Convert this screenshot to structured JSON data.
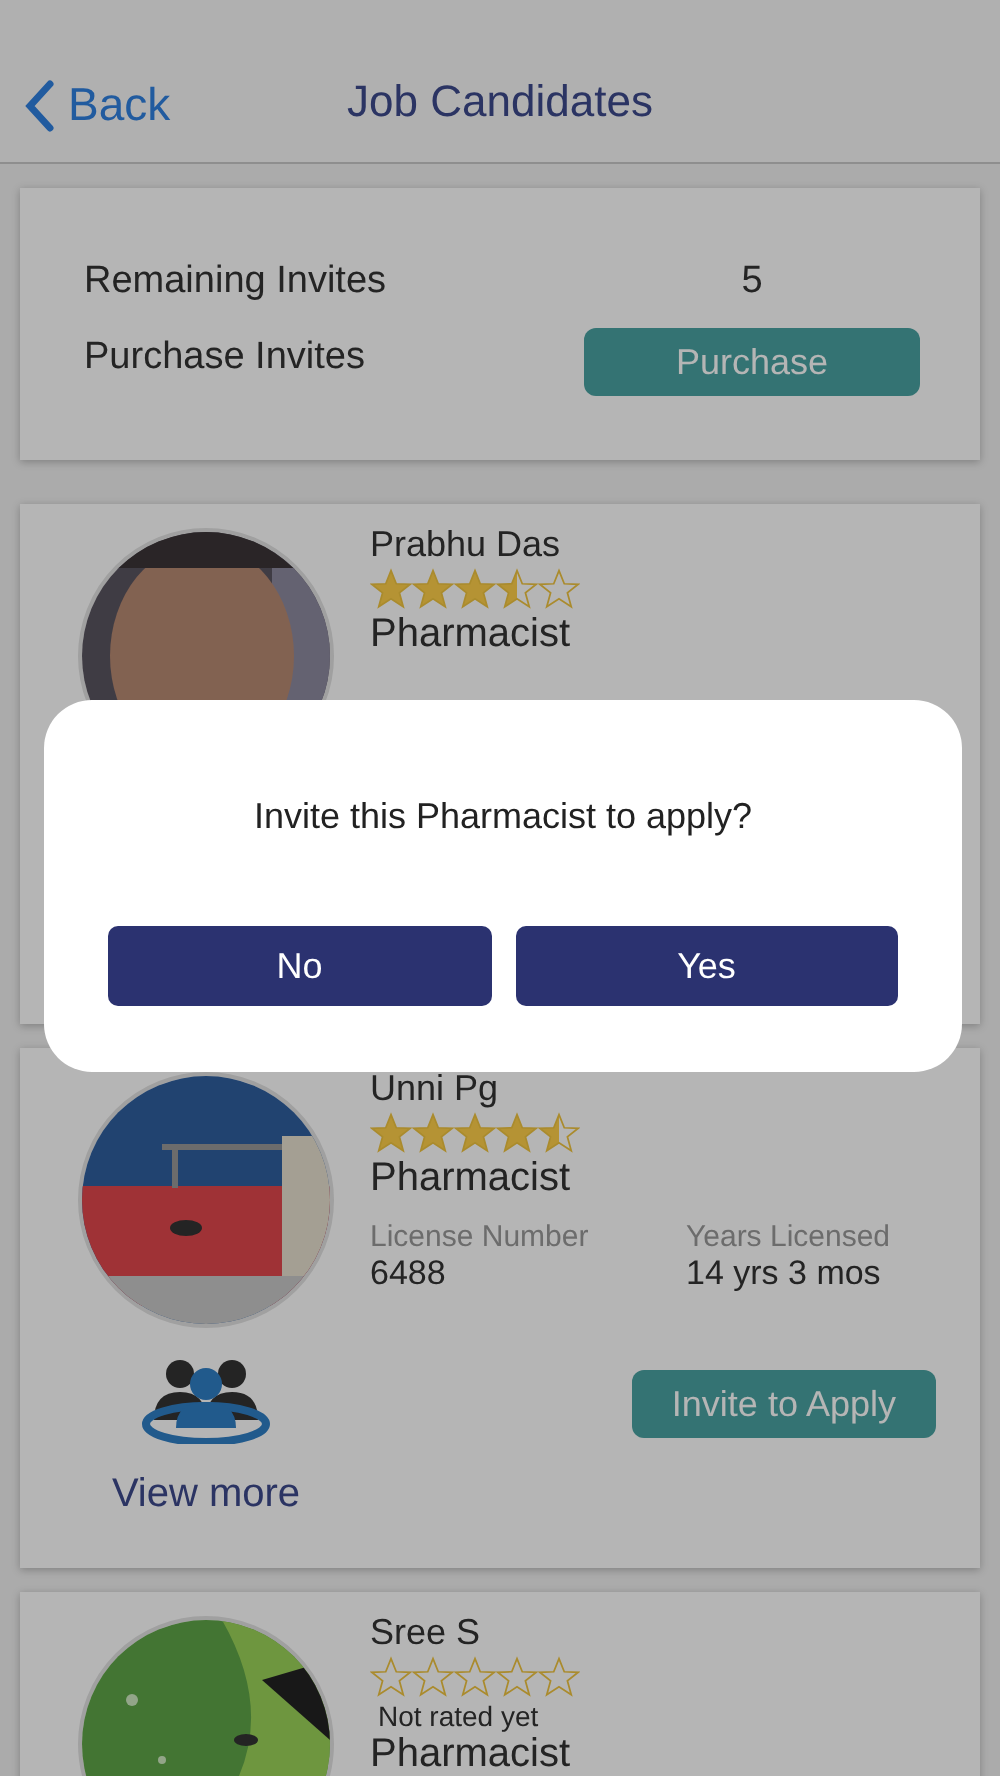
{
  "header": {
    "back": "Back",
    "title": "Job Candidates"
  },
  "invites": {
    "remaining_label": "Remaining Invites",
    "remaining_value": "5",
    "purchase_label": "Purchase Invites",
    "purchase_button": "Purchase"
  },
  "candidates": [
    {
      "name": "Prabhu Das",
      "stars": 3.5,
      "title": "Pharmacist"
    },
    {
      "name": "Unni Pg",
      "stars": 4.5,
      "title": "Pharmacist",
      "license_label": "License Number",
      "license_number": "6488",
      "years_label": "Years Licensed",
      "years_value": "14 yrs 3 mos",
      "invite_button": "Invite to Apply",
      "view_more": "View more"
    },
    {
      "name": "Sree S",
      "stars": 0,
      "rating_note": "Not rated yet",
      "title": "Pharmacist"
    }
  ],
  "dialog": {
    "message": "Invite this Pharmacist to apply?",
    "buttons": [
      "No",
      "Yes"
    ]
  }
}
